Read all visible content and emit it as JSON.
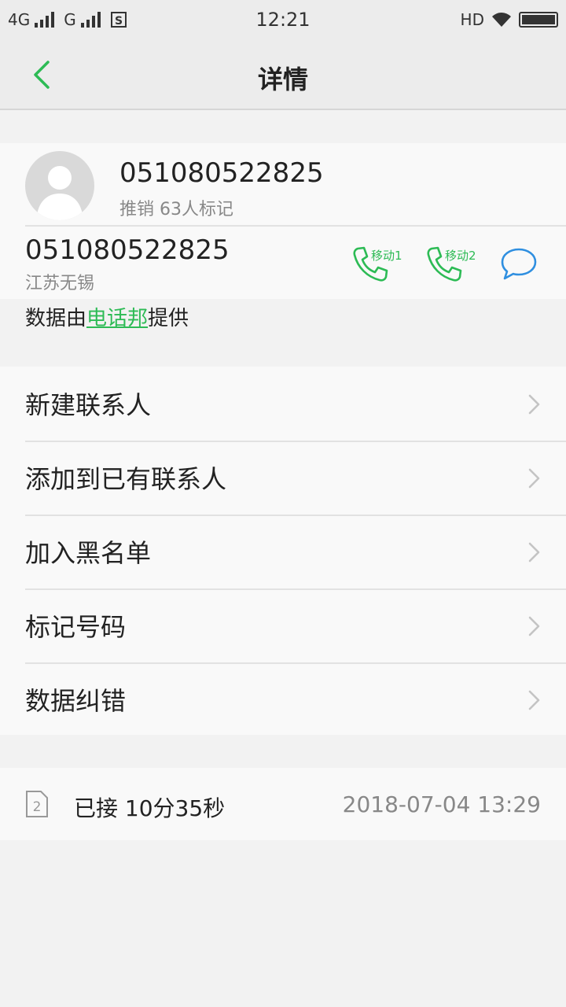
{
  "status_bar": {
    "network1": "4G",
    "network2": "G",
    "time": "12:21",
    "hd": "HD"
  },
  "header": {
    "title": "详情"
  },
  "contact": {
    "number": "051080522825",
    "tag": "推销 63人标记",
    "phone": "051080522825",
    "location": "江苏无锡",
    "call_sim1_label": "移动1",
    "call_sim2_label": "移动2"
  },
  "source": {
    "prefix": "数据由",
    "link": "电话邦",
    "suffix": "提供"
  },
  "menu": {
    "items": [
      {
        "label": "新建联系人"
      },
      {
        "label": "添加到已有联系人"
      },
      {
        "label": "加入黑名单"
      },
      {
        "label": "标记号码"
      },
      {
        "label": "数据纠错"
      }
    ]
  },
  "record": {
    "sim_number": "2",
    "status": "已接 10分35秒",
    "datetime": "2018-07-04 13:29"
  },
  "colors": {
    "accent": "#2dbb55",
    "message_blue": "#2f8fe0"
  }
}
